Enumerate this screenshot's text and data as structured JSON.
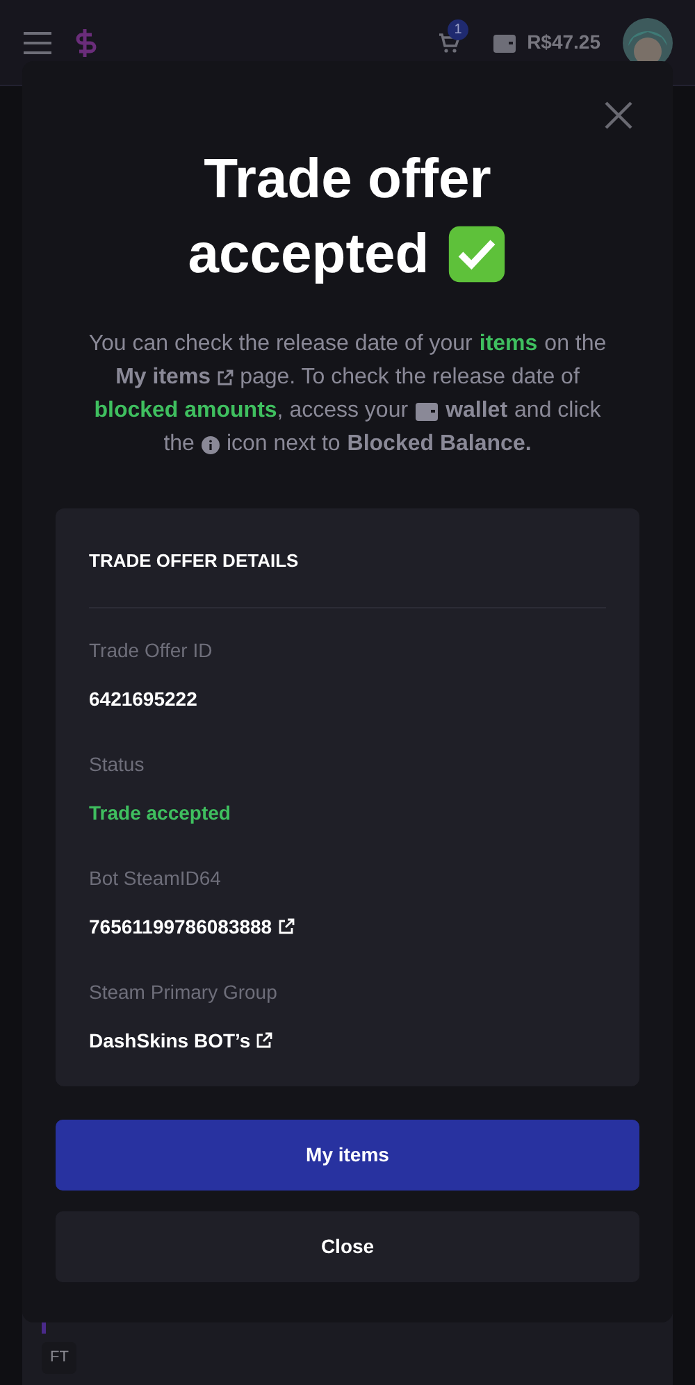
{
  "header": {
    "cart_count": "1",
    "balance": "R$47.25"
  },
  "modal": {
    "title_lines": [
      "Trade offer",
      "accepted"
    ],
    "message": [
      [
        {
          "kind": "text",
          "text": "You can check the release date of your"
        },
        {
          "kind": "green",
          "text": "items"
        },
        {
          "kind": "text",
          "text": "on the"
        }
      ],
      [
        {
          "kind": "link",
          "text": "My items"
        },
        {
          "kind": "text",
          "text": "page. To check the release date of"
        }
      ],
      [
        {
          "kind": "green",
          "text": "blocked amounts"
        },
        {
          "kind": "comma",
          "text": ", access your"
        },
        {
          "kind": "wallet",
          "text": "wallet"
        },
        {
          "kind": "text",
          "text": "and click"
        }
      ],
      [
        {
          "kind": "text",
          "text": "the"
        },
        {
          "kind": "info",
          "text": "icon next to"
        },
        {
          "kind": "bold",
          "text": "Blocked Balance."
        }
      ]
    ],
    "details": {
      "heading": "TRADE OFFER DETAILS",
      "fields": [
        {
          "label": "Trade Offer ID",
          "value": "6421695222",
          "kind": "plain"
        },
        {
          "label": "Status",
          "value": "Trade accepted",
          "kind": "status"
        },
        {
          "label": "Bot SteamID64",
          "value": "76561199786083888",
          "kind": "link"
        },
        {
          "label": "Steam Primary Group",
          "value": "DashSkins BOT’s",
          "kind": "link"
        }
      ]
    },
    "buttons": [
      {
        "label": "My items",
        "kind": "primary"
      },
      {
        "label": "Close",
        "kind": "secondary"
      }
    ]
  },
  "background": {
    "tag": "FT"
  }
}
